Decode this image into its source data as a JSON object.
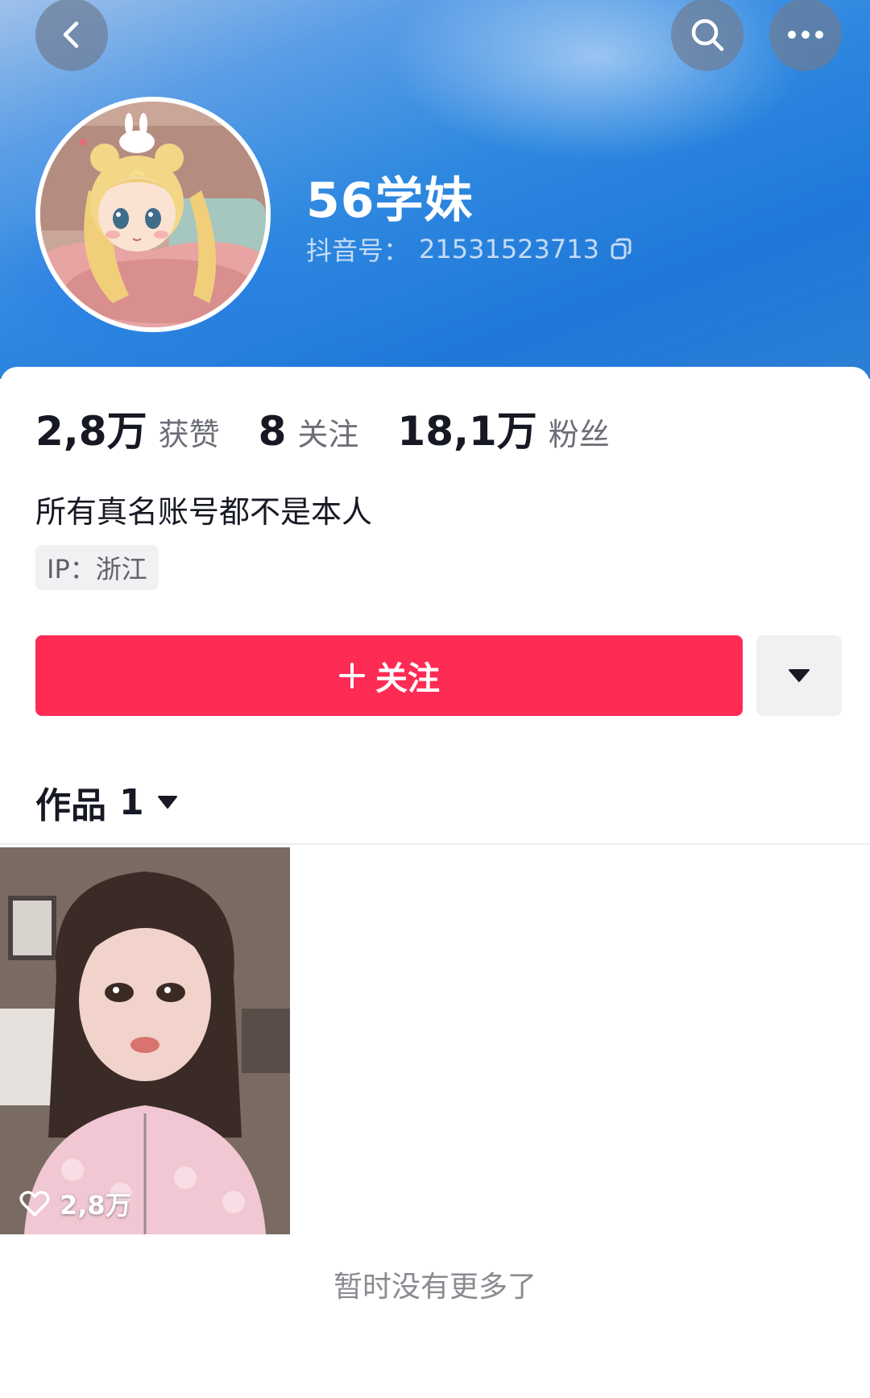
{
  "header": {
    "username": "56学妹",
    "id_label": "抖音号：",
    "id_value": "21531523713"
  },
  "stats": [
    {
      "value": "2,8万",
      "label": "获赞"
    },
    {
      "value": "8",
      "label": "关注"
    },
    {
      "value": "18,1万",
      "label": "粉丝"
    }
  ],
  "bio": "所有真名账号都不是本人",
  "ip_tag": "IP：浙江",
  "actions": {
    "follow_label": "关注"
  },
  "tabs": {
    "works_label": "作品",
    "works_count": "1"
  },
  "videos": [
    {
      "likes": "2,8万"
    }
  ],
  "footer": {
    "no_more": "暂时没有更多了"
  },
  "colors": {
    "follow": "#fe2c55",
    "header_blue": "#2e88e0"
  }
}
